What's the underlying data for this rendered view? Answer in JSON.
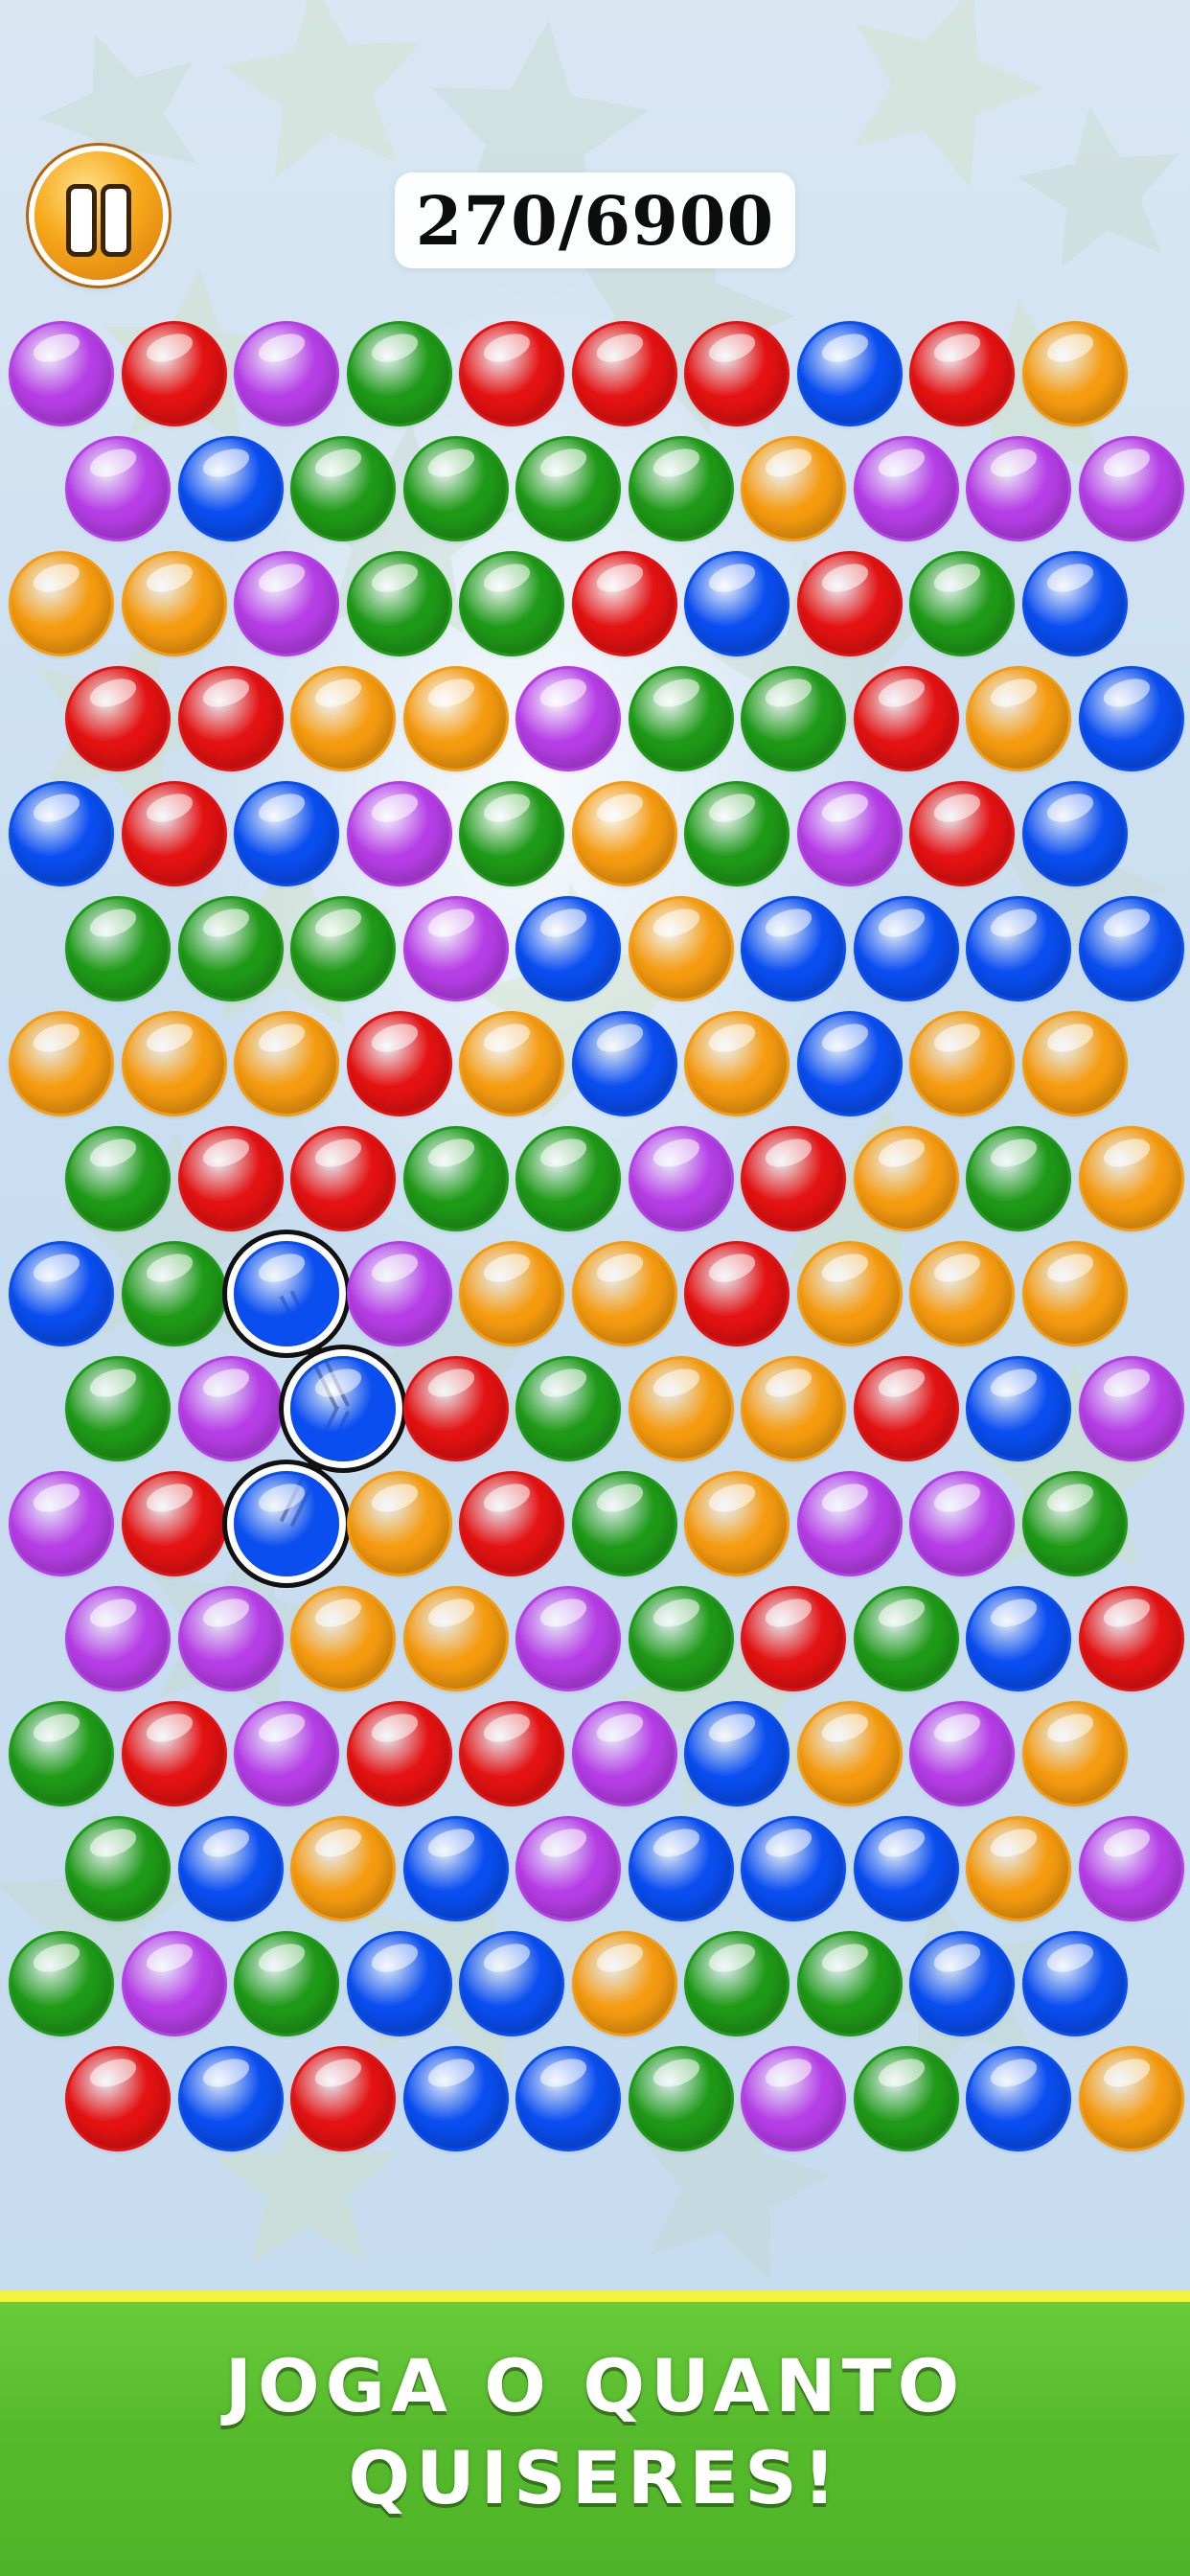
{
  "score": {
    "text": "270/6900",
    "current": 270,
    "target": 6900
  },
  "pause_button": {
    "icon": "pause-icon"
  },
  "banner": {
    "line1": "JOGA O QUANTO",
    "line2": "QUISERES!"
  },
  "colors": {
    "purple": "#b63ee6",
    "red": "#e41212",
    "green": "#1f9a18",
    "blue": "#0a4ef0",
    "orange": "#f59b10",
    "banner_green": "#56bb2c",
    "banner_edge": "#f4f23a"
  },
  "board": {
    "rows": [
      [
        "P",
        "R",
        "P",
        "G",
        "R",
        "R",
        "R",
        "B",
        "R",
        "O"
      ],
      [
        "P",
        "B",
        "G",
        "G",
        "G",
        "G",
        "O",
        "P",
        "P",
        "P"
      ],
      [
        "O",
        "O",
        "P",
        "G",
        "G",
        "R",
        "B",
        "R",
        "G",
        "B"
      ],
      [
        "R",
        "R",
        "O",
        "O",
        "P",
        "G",
        "G",
        "R",
        "O",
        "B"
      ],
      [
        "B",
        "R",
        "B",
        "P",
        "G",
        "O",
        "G",
        "P",
        "R",
        "B"
      ],
      [
        "G",
        "G",
        "G",
        "P",
        "B",
        "O",
        "B",
        "B",
        "B",
        "B"
      ],
      [
        "O",
        "O",
        "O",
        "R",
        "O",
        "B",
        "O",
        "B",
        "O",
        "O"
      ],
      [
        "G",
        "R",
        "R",
        "G",
        "G",
        "P",
        "R",
        "O",
        "G",
        "O"
      ],
      [
        "B",
        "G",
        "B",
        "P",
        "O",
        "O",
        "R",
        "O",
        "O",
        "O"
      ],
      [
        "G",
        "P",
        "B",
        "R",
        "G",
        "O",
        "O",
        "R",
        "B",
        "P"
      ],
      [
        "P",
        "R",
        "B",
        "O",
        "R",
        "G",
        "O",
        "P",
        "P",
        "G"
      ],
      [
        "P",
        "P",
        "O",
        "O",
        "P",
        "G",
        "R",
        "G",
        "B",
        "R"
      ],
      [
        "G",
        "R",
        "P",
        "R",
        "R",
        "P",
        "B",
        "O",
        "P",
        "O"
      ],
      [
        "G",
        "B",
        "O",
        "B",
        "P",
        "B",
        "B",
        "B",
        "O",
        "P"
      ],
      [
        "G",
        "P",
        "G",
        "B",
        "B",
        "O",
        "G",
        "G",
        "B",
        "B"
      ],
      [
        "R",
        "B",
        "R",
        "B",
        "B",
        "G",
        "P",
        "G",
        "B",
        "O"
      ]
    ],
    "selected_chain": [
      [
        8,
        2
      ],
      [
        9,
        2
      ],
      [
        10,
        2
      ]
    ]
  }
}
